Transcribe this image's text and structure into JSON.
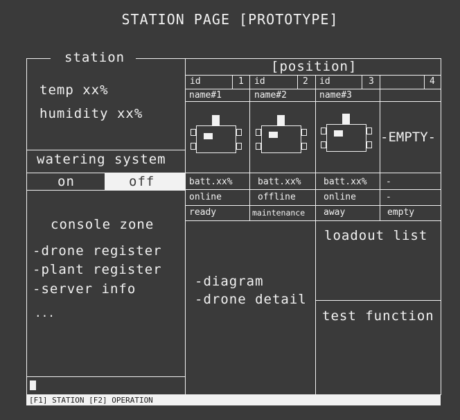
{
  "page_title": "STATION PAGE [PROTOTYPE]",
  "station": {
    "label": "station",
    "temp": "temp xx%",
    "humidity": "humidity xx%"
  },
  "watering": {
    "label": "watering system",
    "on_label": "on",
    "off_label": "off"
  },
  "console": {
    "label": "console zone",
    "items": [
      "-drone register",
      "-plant register",
      "-server info",
      "..."
    ]
  },
  "positions": {
    "label": "[position]",
    "slots": [
      {
        "id_label": "id",
        "number": "1",
        "name": "name#1",
        "battery": "batt.xx%",
        "connection": "online",
        "state": "ready"
      },
      {
        "id_label": "id",
        "number": "2",
        "name": "name#2",
        "battery": "batt.xx%",
        "connection": "offline",
        "state": "maintenance"
      },
      {
        "id_label": "id",
        "number": "3",
        "name": "name#3",
        "battery": "batt.xx%",
        "connection": "online",
        "state": "away"
      },
      {
        "id_label": "",
        "number": "4",
        "name": "",
        "empty_label": "-EMPTY-",
        "battery": "-",
        "connection": "-",
        "state": "empty"
      }
    ]
  },
  "detail": {
    "items": [
      "-diagram",
      "-drone detail"
    ]
  },
  "loadout": {
    "label": "loadout list"
  },
  "test": {
    "label": "test function"
  },
  "statusbar": {
    "text": "[F1] STATION [F2] OPERATION"
  }
}
